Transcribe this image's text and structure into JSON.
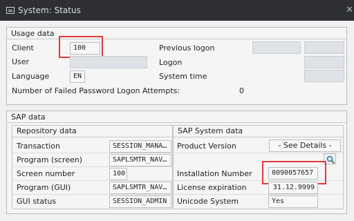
{
  "window": {
    "title": "System: Status"
  },
  "usage": {
    "title": "Usage data",
    "client_label": "Client",
    "client_value": "100",
    "user_label": "User",
    "user_value": "",
    "language_label": "Language",
    "language_value": "EN",
    "previous_logon_label": "Previous logon",
    "logon_label": "Logon",
    "system_time_label": "System time",
    "failed_attempts_label": "Number of Failed Password Logon Attempts:",
    "failed_attempts_value": "0"
  },
  "sap": {
    "title": "SAP data",
    "repository": {
      "title": "Repository data",
      "rows": [
        {
          "label": "Transaction",
          "value": "SESSION_MANA…"
        },
        {
          "label": "Program (screen)",
          "value": "SAPLSMTR_NAV…"
        },
        {
          "label": "Screen number",
          "value": "100"
        },
        {
          "label": "Program (GUI)",
          "value": "SAPLSMTR_NAV…"
        },
        {
          "label": "GUI status",
          "value": "SESSION_ADMIN"
        }
      ]
    },
    "system": {
      "title": "SAP System data",
      "product_version_label": "Product Version",
      "product_version_value": "- See Details -",
      "installation_number_label": "Installation Number",
      "installation_number_value": "0090057657",
      "license_expiration_label": "License expiration",
      "license_expiration_value": "31.12.9999",
      "unicode_label": "Unicode System",
      "unicode_value": "Yes"
    }
  },
  "colors": {
    "highlight": "#e2383c",
    "titlebar": "#2d2f33"
  }
}
